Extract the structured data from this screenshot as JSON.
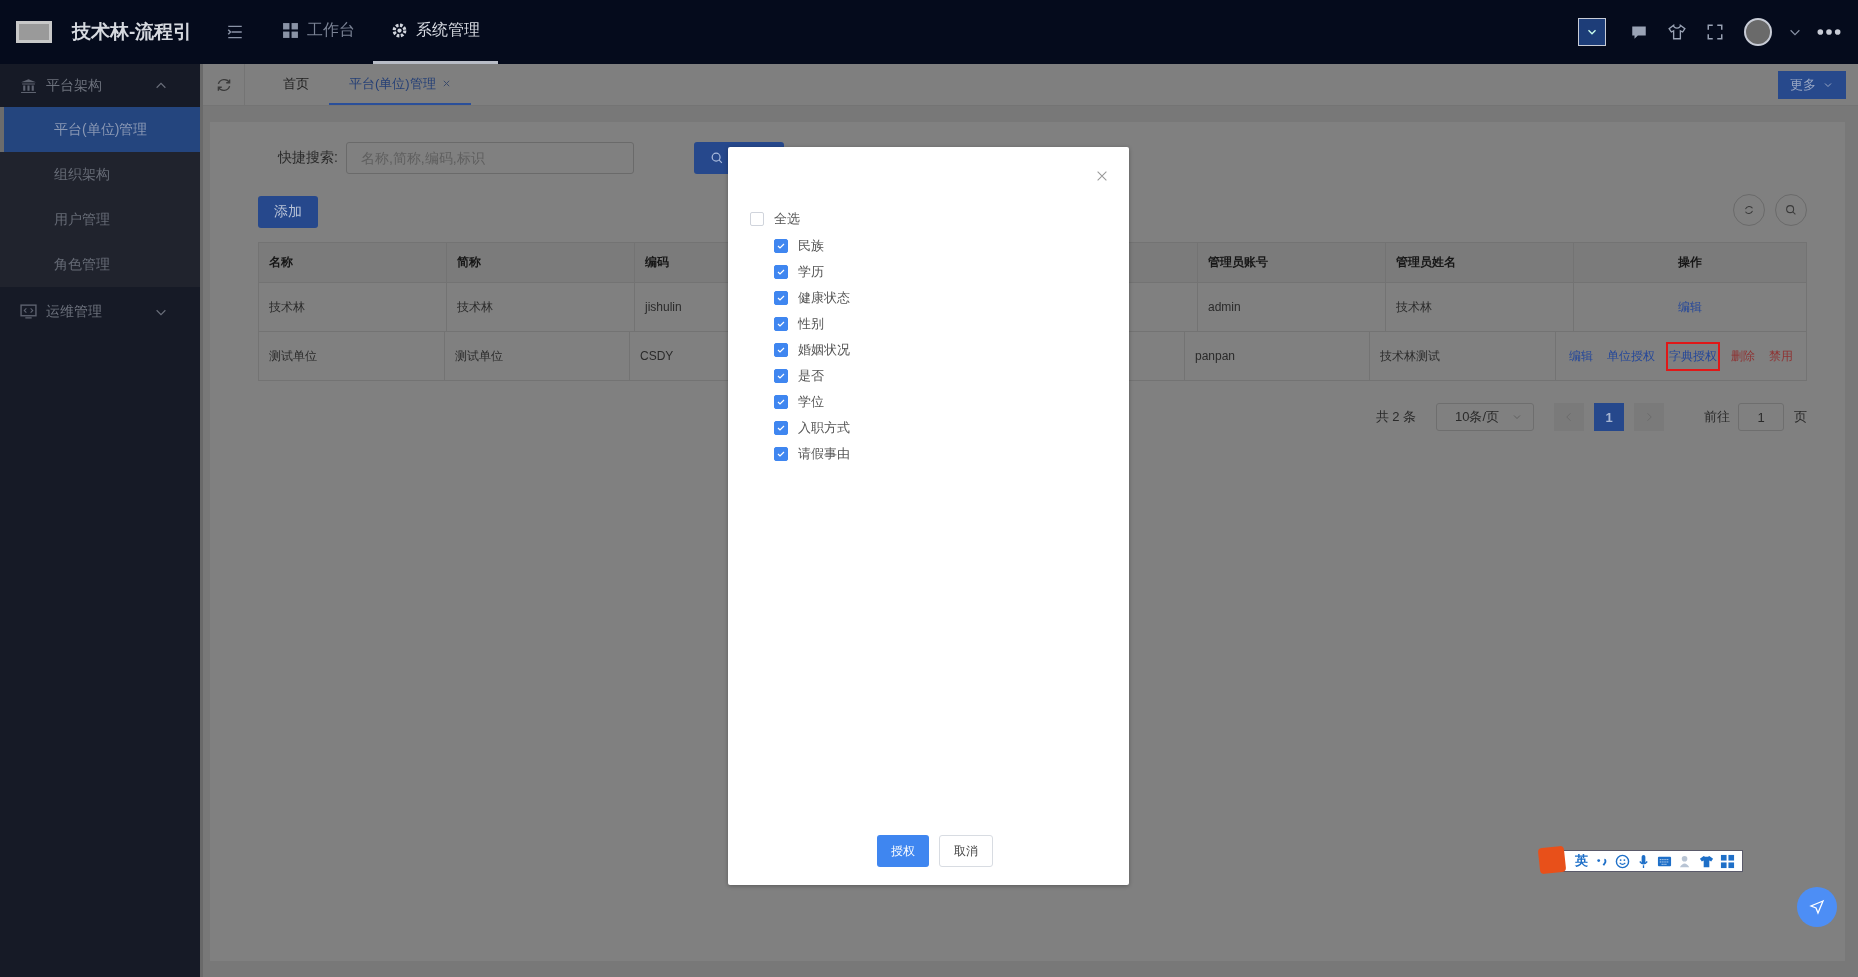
{
  "header": {
    "title": "技术林-流程引",
    "nav": [
      {
        "label": "工作台",
        "selected": false
      },
      {
        "label": "系统管理",
        "selected": true
      }
    ]
  },
  "sidebar": {
    "groups": [
      {
        "label": "平台架构",
        "expanded": true,
        "children": [
          {
            "label": "平台(单位)管理",
            "selected": true
          },
          {
            "label": "组织架构",
            "selected": false
          },
          {
            "label": "用户管理",
            "selected": false
          },
          {
            "label": "角色管理",
            "selected": false
          }
        ]
      },
      {
        "label": "运维管理",
        "expanded": false
      }
    ]
  },
  "tabs": [
    {
      "label": "首页",
      "selected": false,
      "closable": false
    },
    {
      "label": "平台(单位)管理",
      "selected": true,
      "closable": true
    }
  ],
  "more_button": "更多",
  "search": {
    "label": "快捷搜索:",
    "placeholder": "名称,简称,编码,标识"
  },
  "add_button": "添加",
  "table": {
    "columns": [
      "名称",
      "简称",
      "编码",
      "管理员账号",
      "管理员姓名",
      "操作"
    ],
    "rows": [
      {
        "cells": [
          "技术林",
          "技术林",
          "jishulin",
          "admin",
          "技术林"
        ],
        "actions": [
          {
            "label": "编辑",
            "kind": "primary",
            "highlighted": false
          }
        ]
      },
      {
        "cells": [
          "测试单位",
          "测试单位",
          "CSDY",
          "panpan",
          "技术林测试"
        ],
        "actions": [
          {
            "label": "编辑",
            "kind": "primary",
            "highlighted": false
          },
          {
            "label": "单位授权",
            "kind": "primary",
            "highlighted": false
          },
          {
            "label": "字典授权",
            "kind": "primary",
            "highlighted": true
          },
          {
            "label": "删除",
            "kind": "danger",
            "highlighted": false
          },
          {
            "label": "禁用",
            "kind": "danger",
            "highlighted": false
          }
        ]
      }
    ]
  },
  "pagination": {
    "total": "共 2 条",
    "page_size": "10条/页",
    "pages": [
      {
        "label": "1",
        "selected": true
      }
    ],
    "goto_label": "前往",
    "goto_value": "1",
    "page_suffix": "页"
  },
  "modal": {
    "select_all": {
      "label": "全选",
      "checked": false
    },
    "items": [
      {
        "label": "民族",
        "checked": true
      },
      {
        "label": "学历",
        "checked": true
      },
      {
        "label": "健康状态",
        "checked": true
      },
      {
        "label": "性别",
        "checked": true
      },
      {
        "label": "婚姻状况",
        "checked": true
      },
      {
        "label": "是否",
        "checked": true
      },
      {
        "label": "学位",
        "checked": true
      },
      {
        "label": "入职方式",
        "checked": true
      },
      {
        "label": "请假事由",
        "checked": true
      }
    ],
    "confirm_button": "授权",
    "cancel_button": "取消"
  },
  "ime_toolbar": {
    "mode": "英"
  }
}
